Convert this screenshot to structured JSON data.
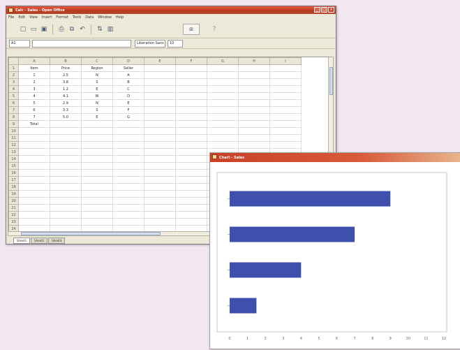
{
  "spreadsheet_window": {
    "title": "Calc - Sales - Open Office",
    "menu": [
      "File",
      "Edit",
      "View",
      "Insert",
      "Format",
      "Tools",
      "Data",
      "Window",
      "Help"
    ],
    "toolbar_icons": [
      "new-doc-icon",
      "open-folder-icon",
      "save-icon",
      "print-icon",
      "copy-icon",
      "undo-icon",
      "sort-icon",
      "chart-icon",
      "zoom-icon"
    ],
    "cell_ref": "A1",
    "font_name": "Liberation Sans",
    "font_size": "10",
    "column_headers": [
      "",
      "A",
      "B",
      "C",
      "D",
      "E",
      "F",
      "G",
      "H",
      "I"
    ],
    "row_numbers": [
      "1",
      "2",
      "3",
      "4",
      "5",
      "6",
      "7",
      "8",
      "9",
      "10",
      "11",
      "12",
      "13",
      "14",
      "15",
      "16",
      "17",
      "18",
      "19",
      "20",
      "21",
      "22",
      "23",
      "24"
    ],
    "rows": [
      [
        "Item",
        "Price",
        "Region",
        "Seller"
      ],
      [
        "1",
        "2.5",
        "N",
        "A"
      ],
      [
        "2",
        "3.8",
        "S",
        "B"
      ],
      [
        "3",
        "1.2",
        "E",
        "C"
      ],
      [
        "4",
        "4.1",
        "W",
        "D"
      ],
      [
        "5",
        "2.9",
        "N",
        "E"
      ],
      [
        "6",
        "3.3",
        "S",
        "F"
      ],
      [
        "7",
        "5.0",
        "E",
        "G"
      ],
      [
        "Total",
        "",
        "",
        ""
      ]
    ],
    "sheet_tabs": [
      "Sheet1",
      "Sheet2",
      "Sheet3"
    ]
  },
  "chart_window": {
    "title": "Chart - Sales",
    "bar_color": "#3f4fae"
  },
  "chart_data": {
    "type": "bar",
    "orientation": "horizontal",
    "categories": [
      "",
      "",
      "",
      ""
    ],
    "values": [
      9,
      7,
      4,
      1.5
    ],
    "xlim": [
      0,
      12
    ],
    "x_ticks": [
      0,
      1,
      2,
      3,
      4,
      5,
      6,
      7,
      8,
      9,
      10,
      11,
      12
    ],
    "title": "",
    "xlabel": "",
    "ylabel": "",
    "grid": false,
    "legend": "none"
  }
}
